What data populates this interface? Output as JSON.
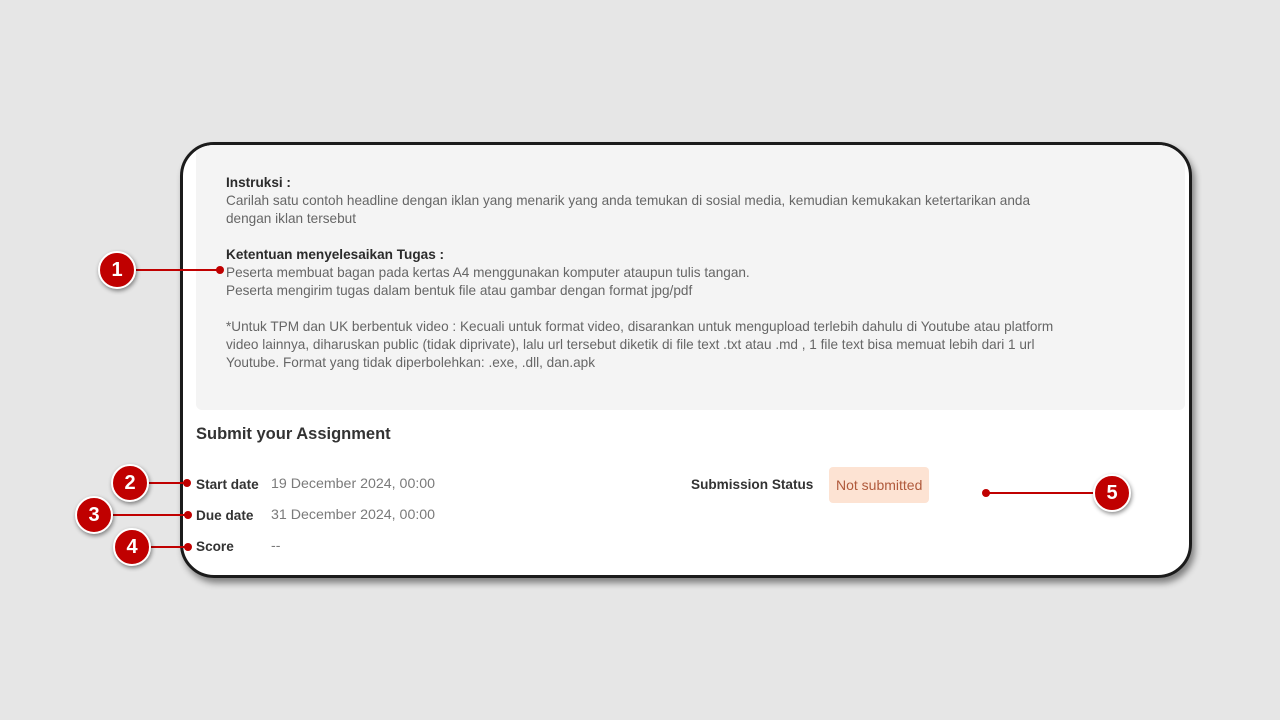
{
  "instructions": {
    "heading1": "Instruksi  :",
    "line1a": "Carilah satu contoh headline dengan iklan  yang menarik yang anda temukan di sosial media, kemudian kemukakan ketertarikan anda",
    "line1b": "dengan iklan tersebut",
    "heading2": "Ketentuan menyelesaikan Tugas :",
    "rule1": "Peserta membuat bagan pada kertas A4 menggunakan komputer ataupun tulis tangan.",
    "rule2": "Peserta mengirim tugas dalam bentuk file atau gambar dengan format jpg/pdf",
    "note_a": "*Untuk TPM dan UK berbentuk video : Kecuali untuk format video, disarankan untuk mengupload terlebih dahulu di Youtube atau platform",
    "note_b": "video lainnya, diharuskan public (tidak diprivate), lalu url tersebut diketik di file text .txt atau .md , 1 file text bisa memuat lebih dari 1 url",
    "note_c": "Youtube. Format yang tidak diperbolehkan: .exe, .dll, dan.apk"
  },
  "submission": {
    "title": "Submit your Assignment",
    "start_label": "Start date",
    "start_value": "19 December 2024, 00:00",
    "due_label": "Due date",
    "due_value": "31 December 2024, 00:00",
    "score_label": "Score",
    "score_value": "--",
    "status_label": "Submission Status",
    "status_value": "Not submitted"
  },
  "callouts": {
    "c1": "1",
    "c2": "2",
    "c3": "3",
    "c4": "4",
    "c5": "5"
  },
  "colors": {
    "accent": "#c00000",
    "badge_bg": "#fde3d3",
    "badge_text": "#b05a3c"
  }
}
